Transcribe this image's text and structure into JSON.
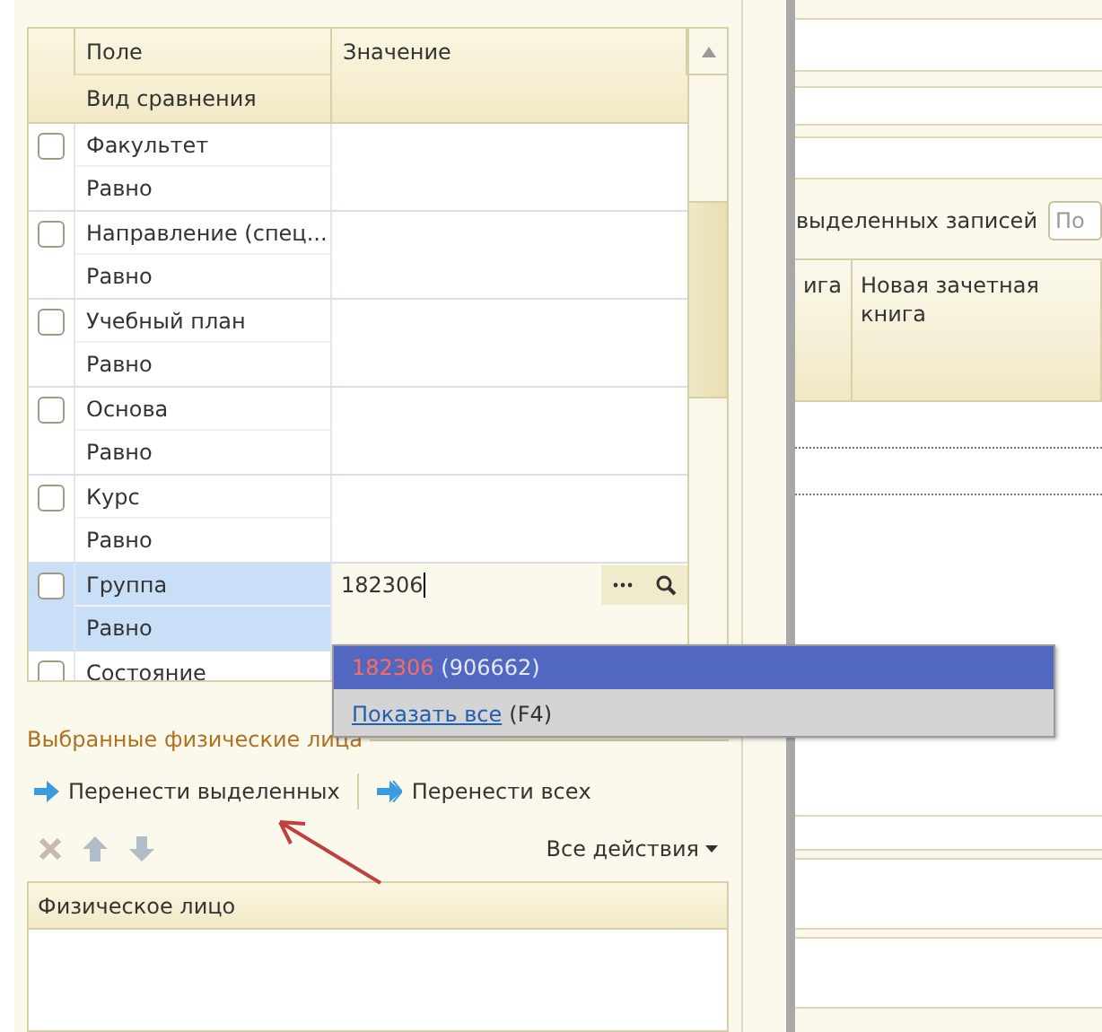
{
  "filter_table": {
    "columns": [
      "Поле",
      "Вид сравнения",
      "Значение"
    ],
    "rows": [
      {
        "field": "Факультет",
        "comparison": "Равно",
        "checked": false,
        "selected": false
      },
      {
        "field": "Направление (спец...",
        "comparison": "Равно",
        "checked": false,
        "selected": false
      },
      {
        "field": "Учебный план",
        "comparison": "Равно",
        "checked": false,
        "selected": false
      },
      {
        "field": "Основа",
        "comparison": "Равно",
        "checked": false,
        "selected": false
      },
      {
        "field": "Курс",
        "comparison": "Равно",
        "checked": false,
        "selected": false
      },
      {
        "field": "Группа",
        "comparison": "Равно",
        "checked": false,
        "selected": true,
        "value": "182306"
      },
      {
        "field": "Состояние",
        "checked": false,
        "selected": false
      }
    ]
  },
  "autocomplete": {
    "items": [
      {
        "kind": "match",
        "match": "182306",
        "detail": "(906662)",
        "selected": true
      },
      {
        "kind": "link",
        "link": "Показать все",
        "detail": "(F4)",
        "selected": false
      }
    ]
  },
  "selected_persons": {
    "title": "Выбранные физические лица",
    "toolbar": [
      "Перенести выделенных",
      "Перенести всех"
    ],
    "actions_menu": "Все действия",
    "table": {
      "columns": [
        "Физическое лицо"
      ]
    }
  },
  "right_panel": {
    "label": "выделенных записей",
    "search": {
      "placeholder": "По"
    },
    "table": {
      "columns": [
        "ига",
        "Новая зачетная книга"
      ]
    }
  }
}
